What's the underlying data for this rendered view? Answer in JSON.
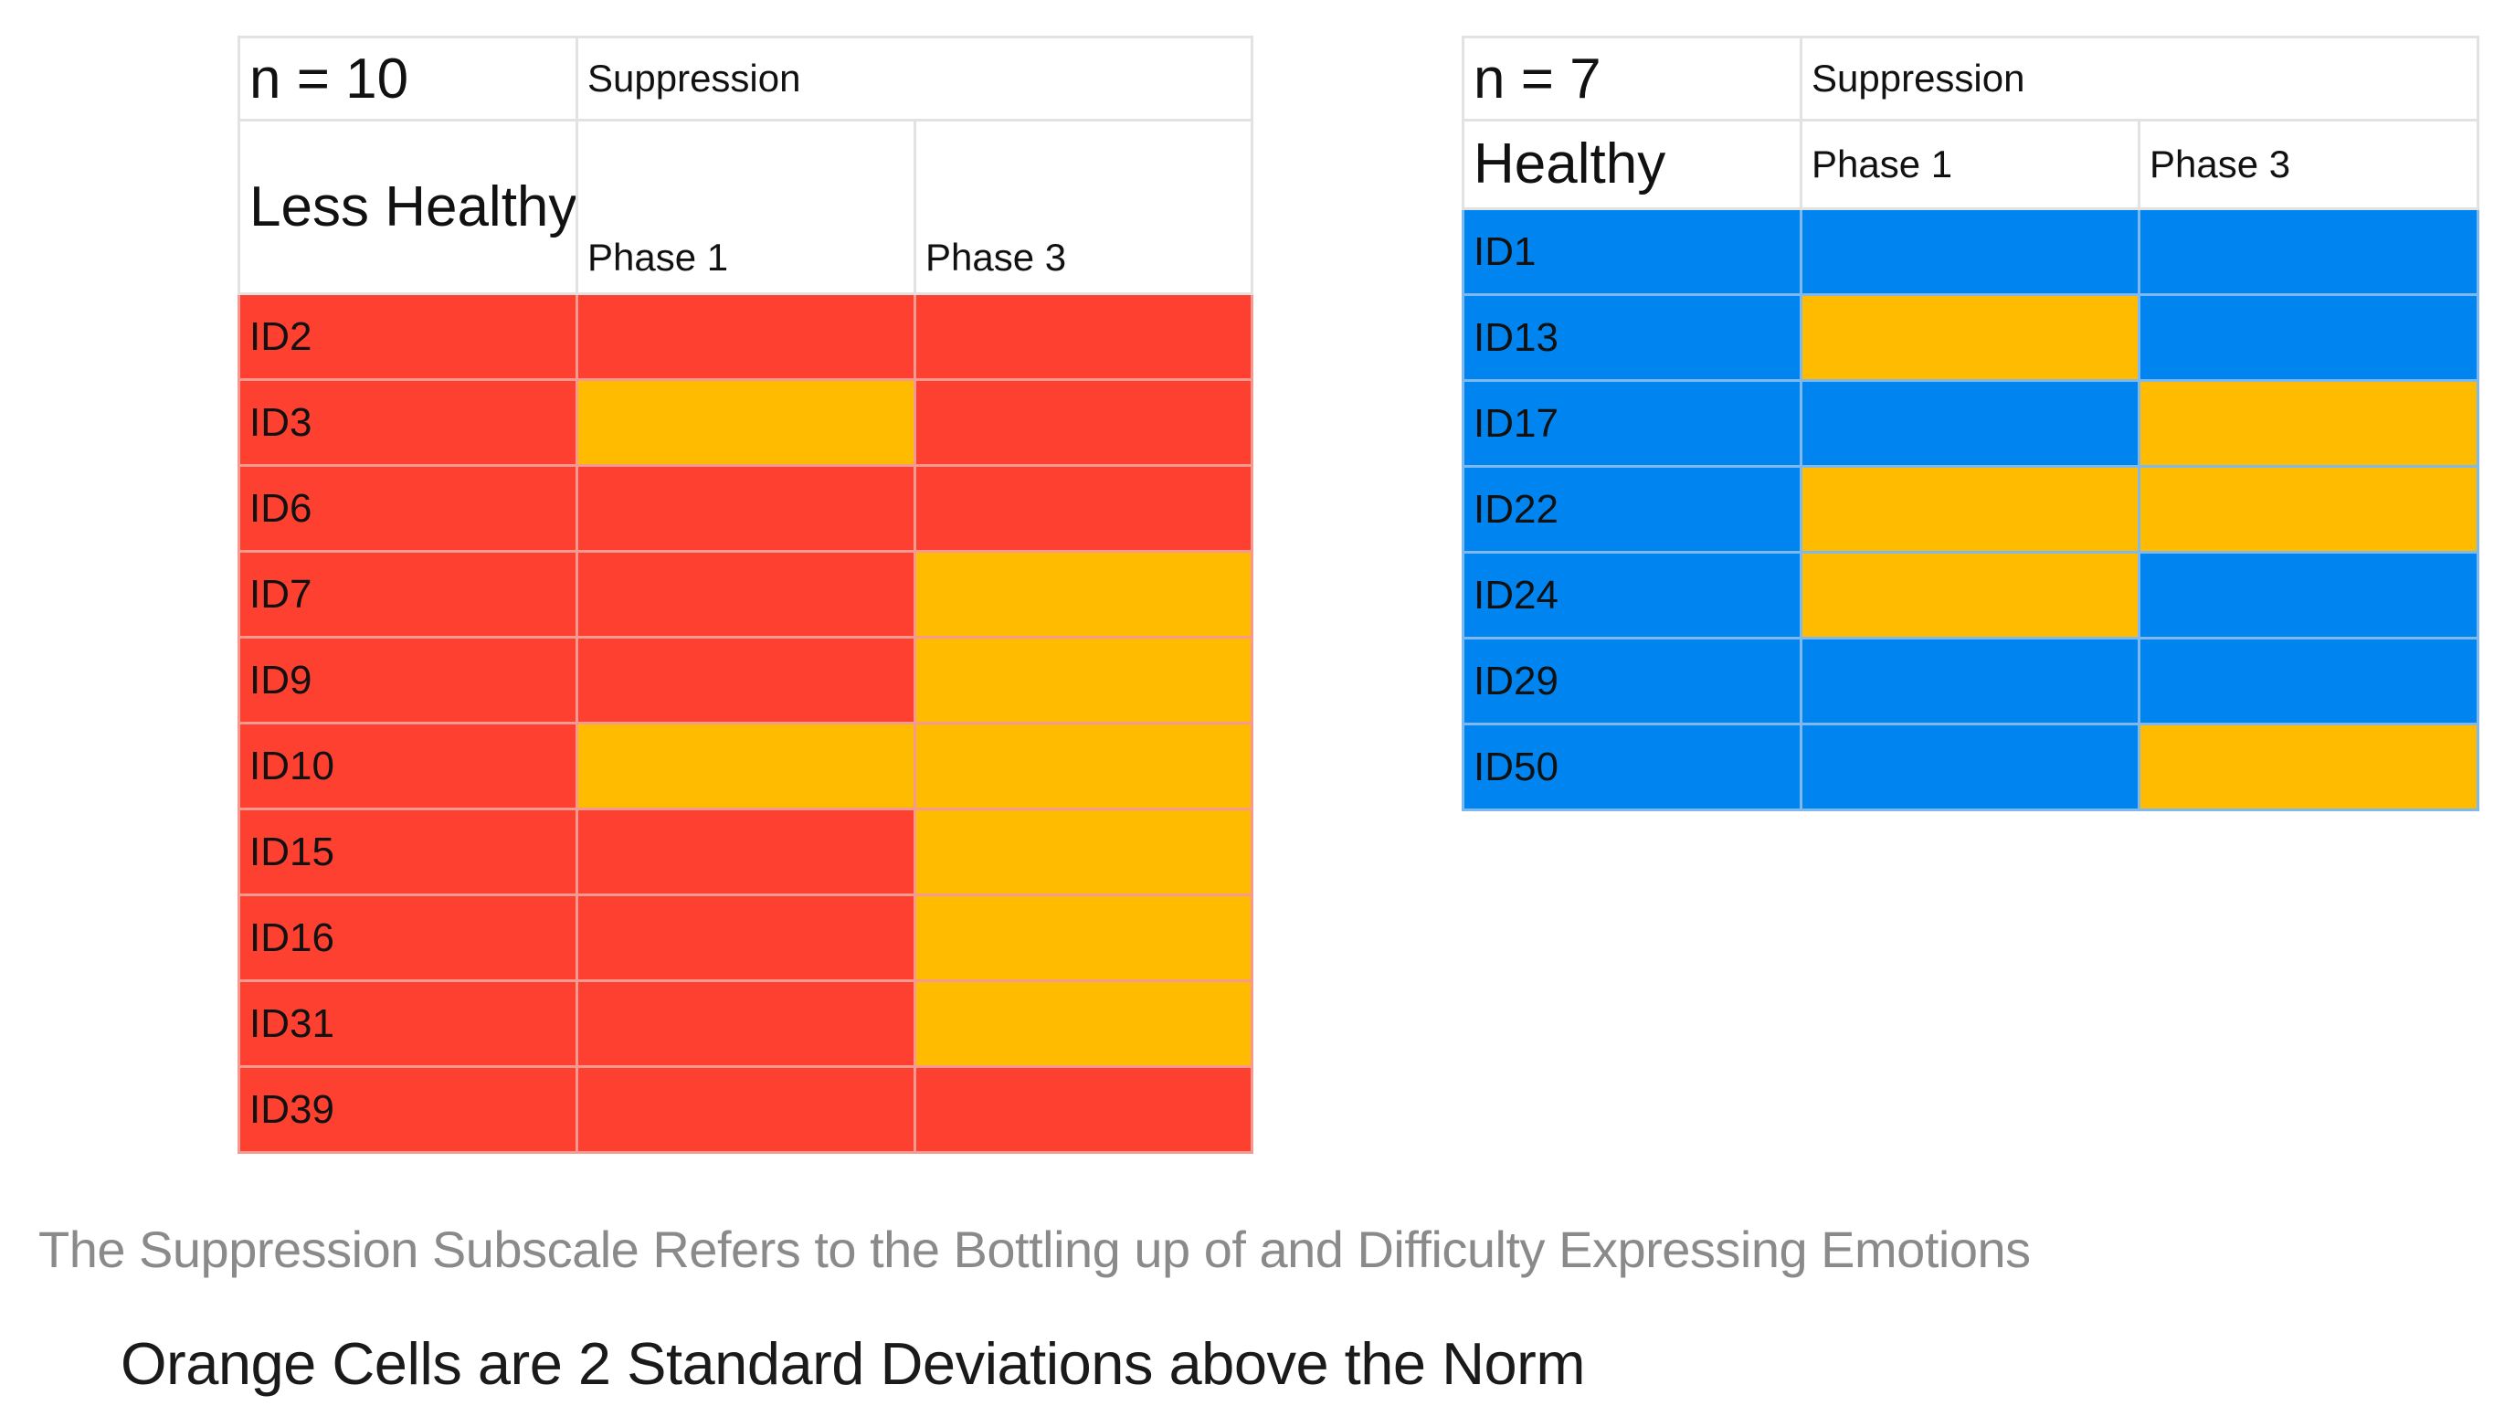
{
  "colors": {
    "red": "#FE4030",
    "orange": "#FFBB00",
    "blue": "#0085F0"
  },
  "left_table": {
    "n_label": "n = 10",
    "measure": "Suppression",
    "group": "Less Healthy",
    "phase1": "Phase 1",
    "phase3": "Phase 3",
    "base_color": "red",
    "rows": [
      {
        "id": "ID2",
        "phase1": "red",
        "phase3": "red"
      },
      {
        "id": "ID3",
        "phase1": "orange",
        "phase3": "red"
      },
      {
        "id": "ID6",
        "phase1": "red",
        "phase3": "red"
      },
      {
        "id": "ID7",
        "phase1": "red",
        "phase3": "orange"
      },
      {
        "id": "ID9",
        "phase1": "red",
        "phase3": "orange"
      },
      {
        "id": "ID10",
        "phase1": "orange",
        "phase3": "orange"
      },
      {
        "id": "ID15",
        "phase1": "red",
        "phase3": "orange"
      },
      {
        "id": "ID16",
        "phase1": "red",
        "phase3": "orange"
      },
      {
        "id": "ID31",
        "phase1": "red",
        "phase3": "orange"
      },
      {
        "id": "ID39",
        "phase1": "red",
        "phase3": "red"
      }
    ]
  },
  "right_table": {
    "n_label": "n = 7",
    "measure": "Suppression",
    "group": "Healthy",
    "phase1": "Phase 1",
    "phase3": "Phase 3",
    "base_color": "blue",
    "rows": [
      {
        "id": "ID1",
        "phase1": "blue",
        "phase3": "blue"
      },
      {
        "id": "ID13",
        "phase1": "orange",
        "phase3": "blue"
      },
      {
        "id": "ID17",
        "phase1": "blue",
        "phase3": "orange"
      },
      {
        "id": "ID22",
        "phase1": "orange",
        "phase3": "orange"
      },
      {
        "id": "ID24",
        "phase1": "orange",
        "phase3": "blue"
      },
      {
        "id": "ID29",
        "phase1": "blue",
        "phase3": "blue"
      },
      {
        "id": "ID50",
        "phase1": "blue",
        "phase3": "orange"
      }
    ]
  },
  "captions": {
    "subscale_note": "The Suppression Subscale Refers to the Bottling up of and Difficulty Expressing Emotions",
    "legend_note": "Orange Cells are 2 Standard Deviations above the Norm"
  }
}
